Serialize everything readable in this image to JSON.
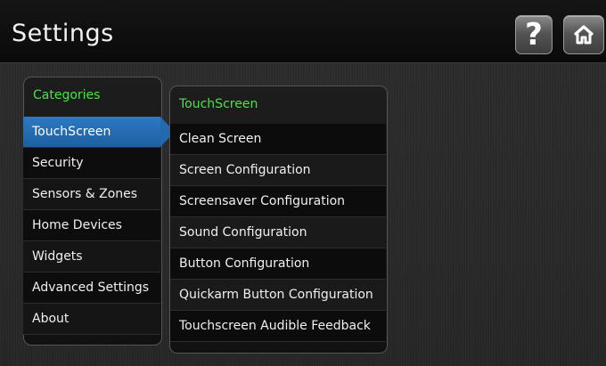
{
  "header": {
    "title": "Settings",
    "help_label": "?",
    "help_icon": "question-icon",
    "home_icon": "home-icon"
  },
  "categories": {
    "heading": "Categories",
    "items": [
      {
        "label": "TouchScreen",
        "selected": true
      },
      {
        "label": "Security"
      },
      {
        "label": "Sensors & Zones"
      },
      {
        "label": "Home Devices"
      },
      {
        "label": "Widgets"
      },
      {
        "label": "Advanced Settings"
      },
      {
        "label": "About"
      }
    ]
  },
  "touchscreen": {
    "heading": "TouchScreen",
    "items": [
      {
        "label": "Clean Screen"
      },
      {
        "label": "Screen Configuration"
      },
      {
        "label": "Screensaver Configuration"
      },
      {
        "label": "Sound Configuration"
      },
      {
        "label": "Button Configuration"
      },
      {
        "label": "Quickarm Button Configuration"
      },
      {
        "label": "Touchscreen Audible Feedback"
      }
    ]
  },
  "colors": {
    "heading_green": "#4be04b",
    "selected_blue": "#2c79c4"
  }
}
